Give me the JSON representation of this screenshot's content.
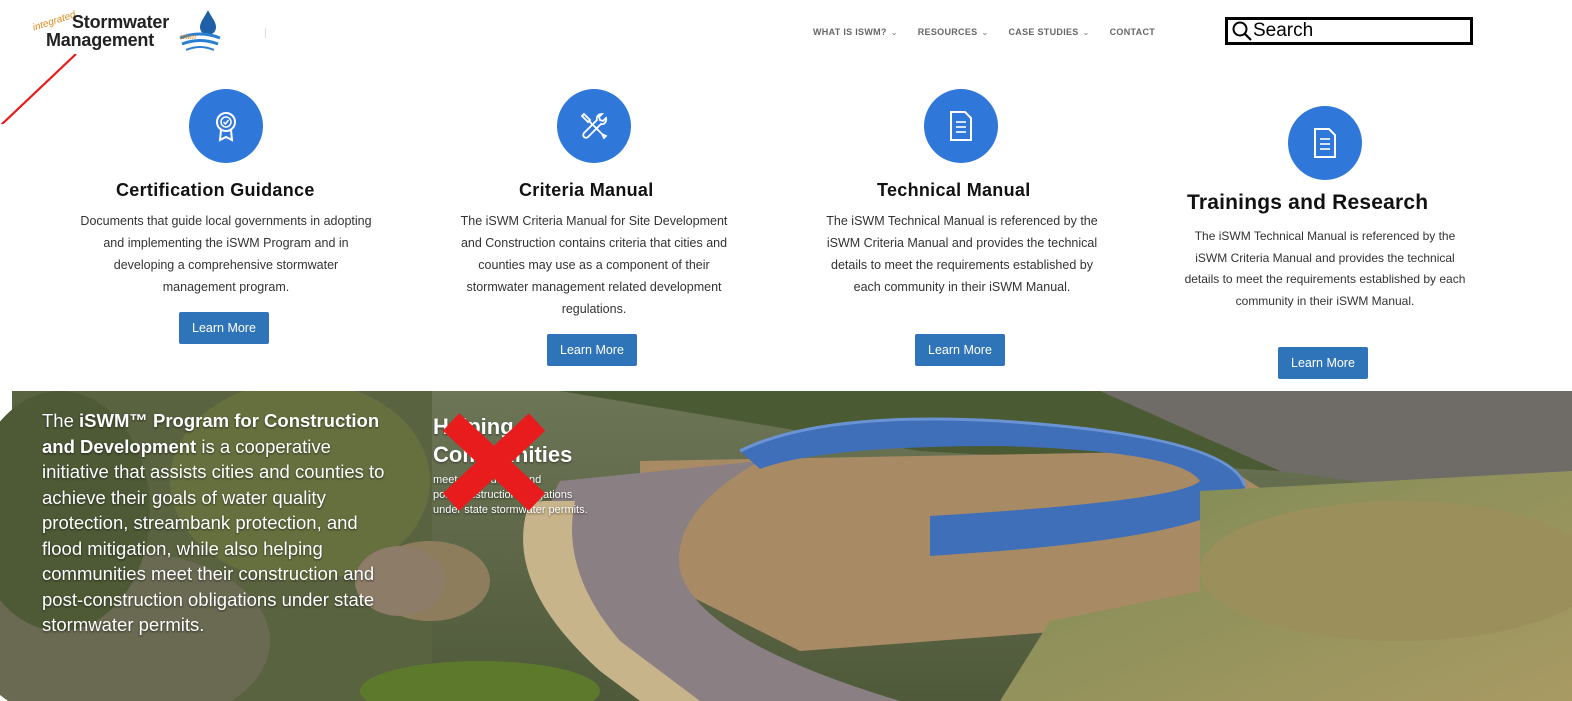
{
  "header": {
    "logo": {
      "tagline": "integrated",
      "line1": "Stormwater",
      "line2": "Management",
      "mark": "iswm"
    },
    "nav": [
      {
        "label": "WHAT IS ISWM?",
        "has_dropdown": true
      },
      {
        "label": "RESOURCES",
        "has_dropdown": true
      },
      {
        "label": "CASE STUDIES",
        "has_dropdown": true
      },
      {
        "label": "CONTACT",
        "has_dropdown": false
      }
    ],
    "search": {
      "value": "Search",
      "icon": "search-icon"
    }
  },
  "cards": [
    {
      "icon": "award-ribbon-icon",
      "title": "Certification Guidance",
      "description": "Documents that guide local governments in adopting and implementing the iSWM Program and in developing a comprehensive stormwater management program.",
      "button": "Learn More"
    },
    {
      "icon": "tools-icon",
      "title": "Criteria Manual",
      "description": "The iSWM Criteria Manual for Site Development and Construction contains criteria that cities and counties may use as a component of their stormwater management related development regulations.",
      "button": "Learn More"
    },
    {
      "icon": "document-icon",
      "title": "Technical Manual",
      "description": "The iSWM Technical Manual is referenced by the iSWM Criteria Manual and provides the technical details to meet the requirements established by each community in their iSWM Manual.",
      "button": "Learn More"
    },
    {
      "icon": "document-icon",
      "title": "Trainings and Research",
      "description": "The iSWM Technical Manual is referenced by the iSWM Criteria Manual and provides the technical details to meet the requirements established by each community in their iSWM Manual.",
      "button": "Learn More"
    }
  ],
  "hero": {
    "text_prefix": "The ",
    "text_bold": "iSWM™ Program for Construction and Development",
    "text_suffix": " is a cooperative initiative that assists cities and counties to achieve their goals of water quality protection, streambank protection, and flood mitigation, while also helping communities meet their construction and post-construction obligations under state stormwater permits.",
    "heading_line1": "Helping",
    "heading_line2": "Communities",
    "sub_line1": "meet construction and",
    "sub_line2": "post-construction obligations",
    "sub_line3": "under state stormwater permits."
  },
  "colors": {
    "icon_circle": "#2f78da",
    "button": "#2f74b8",
    "annotation_red": "#e81c1c"
  }
}
